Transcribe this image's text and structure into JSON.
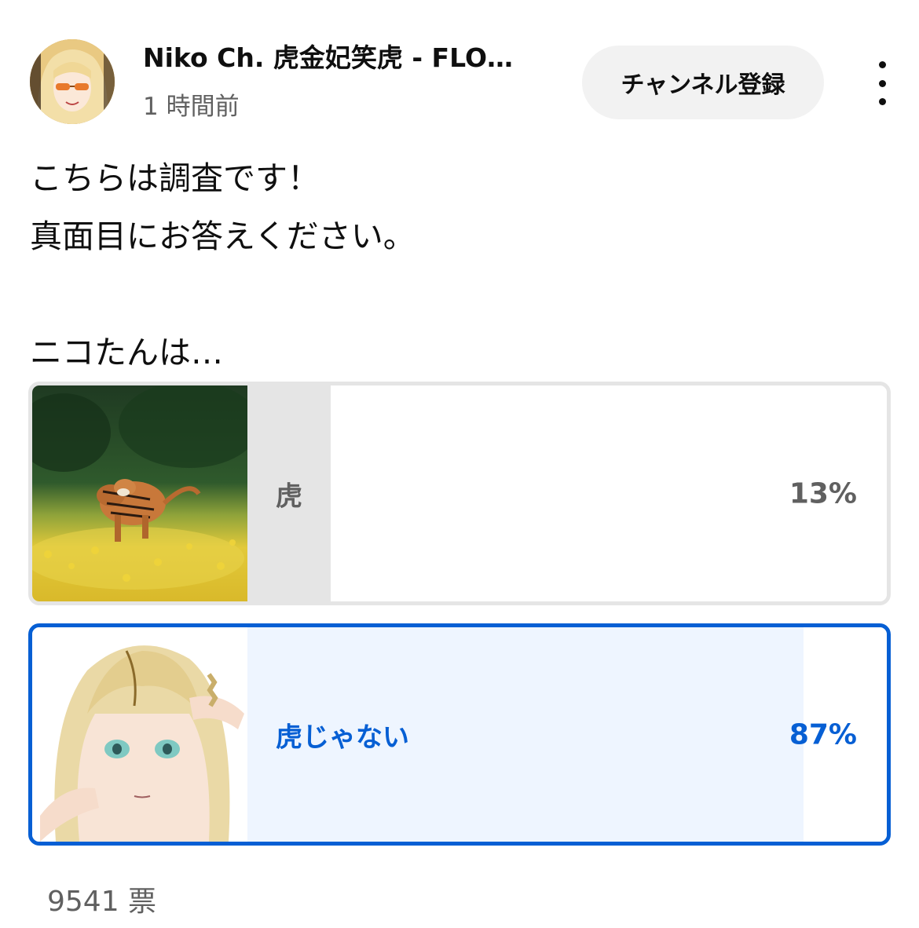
{
  "header": {
    "channel_name": "Niko Ch. 虎金妃笑虎 - FLO…",
    "post_time": "1 時間前",
    "subscribe_label": "チャンネル登録",
    "menu_icon": "more-vert-icon"
  },
  "post": {
    "line1": "こちらは調査です！",
    "line2": "真面目にお答えください。",
    "line3": "ニコたんは…"
  },
  "poll": {
    "options": [
      {
        "label": "虎",
        "percent_text": "13%",
        "percent": 13,
        "image": "tiger-running-in-flowers",
        "selected": false
      },
      {
        "label": "虎じゃない",
        "percent_text": "87%",
        "percent": 87,
        "image": "blonde-anime-girl",
        "selected": true
      }
    ],
    "vote_count": "9541 票"
  },
  "colors": {
    "accent": "#065fd4",
    "selected_fill": "#eef5ff",
    "unselected_fill": "#e5e5e5",
    "secondary_text": "#606060",
    "subscribe_bg": "#f2f2f2"
  }
}
